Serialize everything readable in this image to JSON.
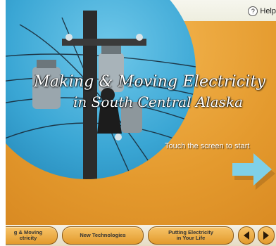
{
  "help": {
    "label": "Help",
    "icon": "question-icon",
    "icon_glyph": "?"
  },
  "title": {
    "line1": "Making & Moving Electricity",
    "line2": "in South Central Alaska"
  },
  "prompt": {
    "text": "Touch the screen to start",
    "arrow_icon": "right-arrow-icon"
  },
  "nav": {
    "buttons": [
      {
        "label": "g & Moving\nctricity"
      },
      {
        "label": "New Technologies"
      },
      {
        "label": "Putting Electricity\nin Your Life"
      }
    ],
    "prev_icon": "prev-arrow-icon",
    "next_icon": "next-arrow-icon"
  },
  "colors": {
    "background": "#e8a13a",
    "photo_circle": "#3aa6d4",
    "arrow": "#7fd0e8"
  }
}
